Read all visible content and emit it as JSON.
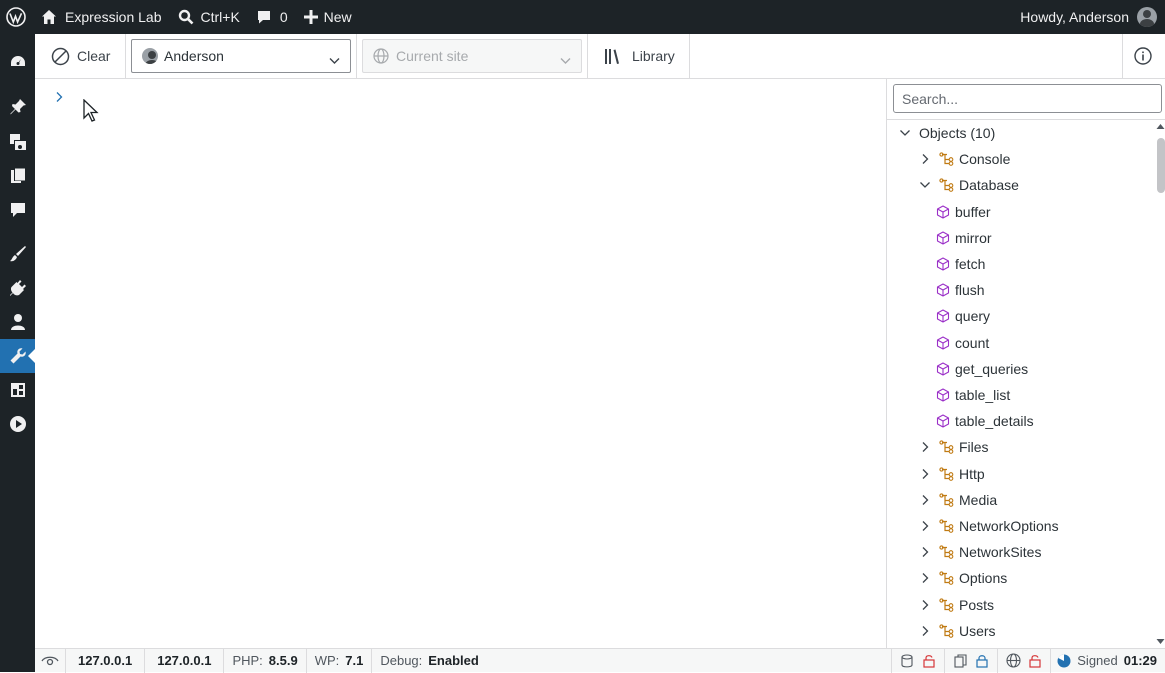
{
  "adminbar": {
    "site_name": "Expression Lab",
    "shortcut": "Ctrl+K",
    "comments_count": "0",
    "new_label": "New",
    "greeting": "Howdy, Anderson"
  },
  "toolbar": {
    "clear_label": "Clear",
    "user_select": "Anderson",
    "site_select": "Current site",
    "library_label": "Library"
  },
  "sidepanel": {
    "search_placeholder": "Search...",
    "tree": [
      {
        "label": "Objects (10)",
        "level": 0,
        "expanded": true,
        "icon": "none"
      },
      {
        "label": "Console",
        "level": 1,
        "expanded": false,
        "icon": "class-icon"
      },
      {
        "label": "Database",
        "level": 1,
        "expanded": true,
        "icon": "class-icon"
      },
      {
        "label": "buffer",
        "level": 2,
        "icon": "method-cube-icon"
      },
      {
        "label": "mirror",
        "level": 2,
        "icon": "method-cube-icon"
      },
      {
        "label": "fetch",
        "level": 2,
        "icon": "method-cube-icon"
      },
      {
        "label": "flush",
        "level": 2,
        "icon": "method-cube-icon"
      },
      {
        "label": "query",
        "level": 2,
        "icon": "method-cube-icon"
      },
      {
        "label": "count",
        "level": 2,
        "icon": "method-cube-icon"
      },
      {
        "label": "get_queries",
        "level": 2,
        "icon": "method-cube-icon"
      },
      {
        "label": "table_list",
        "level": 2,
        "icon": "method-cube-icon"
      },
      {
        "label": "table_details",
        "level": 2,
        "icon": "method-cube-icon"
      },
      {
        "label": "Files",
        "level": 1,
        "expanded": false,
        "icon": "class-icon"
      },
      {
        "label": "Http",
        "level": 1,
        "expanded": false,
        "icon": "class-icon"
      },
      {
        "label": "Media",
        "level": 1,
        "expanded": false,
        "icon": "class-icon"
      },
      {
        "label": "NetworkOptions",
        "level": 1,
        "expanded": false,
        "icon": "class-icon"
      },
      {
        "label": "NetworkSites",
        "level": 1,
        "expanded": false,
        "icon": "class-icon"
      },
      {
        "label": "Options",
        "level": 1,
        "expanded": false,
        "icon": "class-icon"
      },
      {
        "label": "Posts",
        "level": 1,
        "expanded": false,
        "icon": "class-icon"
      },
      {
        "label": "Users",
        "level": 1,
        "expanded": false,
        "icon": "class-icon"
      }
    ]
  },
  "statusbar": {
    "ip_1": "127.0.0.1",
    "ip_2": "127.0.0.1",
    "php_label": "PHP:",
    "php_version": "8.5.9",
    "wp_label": "WP:",
    "wp_version": "7.1",
    "debug_label": "Debug:",
    "debug_value": "Enabled",
    "signed_label": "Signed",
    "time": "01:29"
  },
  "colors": {
    "adminbar_bg": "#1d2327",
    "active_menu": "#2271b1",
    "method_icon": "#9b30c8",
    "class_icon": "#c07a12",
    "danger_icon": "#d63638"
  }
}
